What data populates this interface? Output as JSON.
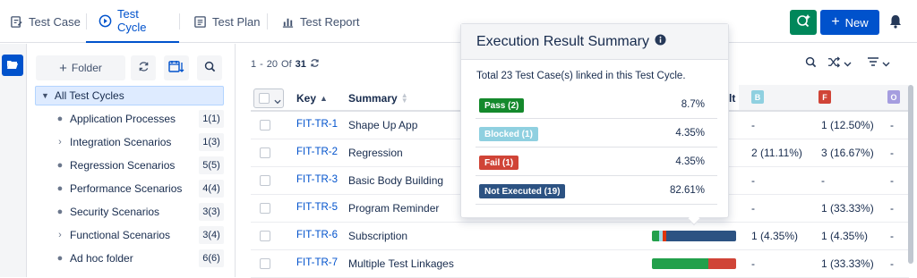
{
  "tabs": [
    {
      "label": "Test Case",
      "icon": "edit-document-icon"
    },
    {
      "label": "Test Cycle",
      "icon": "play-circle-icon"
    },
    {
      "label": "Test Plan",
      "icon": "list-document-icon"
    },
    {
      "label": "Test Report",
      "icon": "bar-chart-icon"
    }
  ],
  "header": {
    "new_label": "New",
    "quick_icon": "quick-search-icon",
    "bell_icon": "bell-icon"
  },
  "tree": {
    "folder_button": "Folder",
    "root": "All Test Cycles",
    "items": [
      {
        "label": "Application Processes",
        "count": "1(1)",
        "expandable": false
      },
      {
        "label": "Integration Scenarios",
        "count": "1(3)",
        "expandable": true
      },
      {
        "label": "Regression Scenarios",
        "count": "5(5)",
        "expandable": false
      },
      {
        "label": "Performance Scenarios",
        "count": "4(4)",
        "expandable": false
      },
      {
        "label": "Security Scenarios",
        "count": "3(3)",
        "expandable": false
      },
      {
        "label": "Functional Scenarios",
        "count": "3(4)",
        "expandable": true
      },
      {
        "label": "Ad hoc folder",
        "count": "6(6)",
        "expandable": false
      }
    ]
  },
  "pager": {
    "start": "1",
    "dash": "-",
    "end": "20",
    "of": "Of",
    "total": "31"
  },
  "table": {
    "headers": {
      "key": "Key",
      "summary": "Summary",
      "b": "B",
      "f": "F",
      "o": "O",
      "execution_tail": "lt"
    },
    "rows": [
      {
        "key": "FIT-TR-1",
        "summary": "Shape Up App",
        "b": "-",
        "f": "1 (12.50%)",
        "o": "-"
      },
      {
        "key": "FIT-TR-2",
        "summary": "Regression",
        "b": "2 (11.11%)",
        "f": "3 (16.67%)",
        "o": "-"
      },
      {
        "key": "FIT-TR-3",
        "summary": "Basic Body Building",
        "b": "-",
        "f": "-",
        "o": "-"
      },
      {
        "key": "FIT-TR-5",
        "summary": "Program Reminder",
        "b": "-",
        "f": "1 (33.33%)",
        "o": "-"
      },
      {
        "key": "FIT-TR-6",
        "summary": "Subscription",
        "b": "1 (4.35%)",
        "f": "1 (4.35%)",
        "o": "-"
      },
      {
        "key": "FIT-TR-7",
        "summary": "Multiple Test Linkages",
        "b": "-",
        "f": "1 (33.33%)",
        "o": "-"
      }
    ],
    "bars": [
      {
        "row": 4,
        "segments": [
          {
            "color": "#22a04b",
            "fraction": 0.087
          },
          {
            "color": "#9fd9e8",
            "fraction": 0.0435
          },
          {
            "color": "#de350b",
            "fraction": 0.0435
          },
          {
            "color": "#2c5282",
            "fraction": 0.8261
          }
        ]
      },
      {
        "row": 5,
        "segments": [
          {
            "color": "#22a04b",
            "fraction": 0.6667
          },
          {
            "color": "#d04437",
            "fraction": 0.3333
          }
        ]
      }
    ]
  },
  "colors": {
    "pass": "#14892c",
    "blocked": "#8fd0e0",
    "fail": "#d04437",
    "not_executed": "#2c5282",
    "b_badge": "#8fd0e0",
    "f_badge": "#d04437",
    "o_badge": "#a59ddf",
    "accent": "#0052cc"
  },
  "popup": {
    "title": "Execution Result Summary",
    "info": "Total 23 Test Case(s) linked in this Test Cycle.",
    "items": [
      {
        "label": "Pass (2)",
        "percent": "8.7%",
        "color": "#14892c",
        "text_color": "#ffffff"
      },
      {
        "label": "Blocked (1)",
        "percent": "4.35%",
        "color": "#8fd0e0",
        "text_color": "#ffffff"
      },
      {
        "label": "Fail (1)",
        "percent": "4.35%",
        "color": "#d04437",
        "text_color": "#ffffff"
      },
      {
        "label": "Not Executed (19)",
        "percent": "82.61%",
        "color": "#2c5282",
        "text_color": "#ffffff"
      }
    ]
  }
}
